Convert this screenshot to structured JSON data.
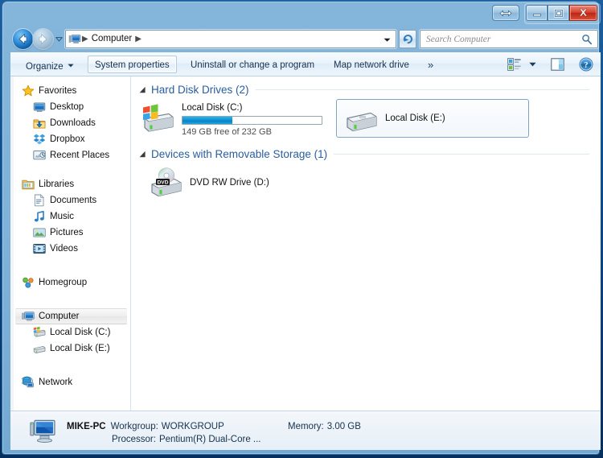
{
  "window": {
    "title": "",
    "buttons": {
      "resize": "resize-restore",
      "minimize": "Minimize",
      "maximize": "Maximize",
      "close": "Close"
    }
  },
  "navigation": {
    "back_label": "Back",
    "forward_label": "Forward",
    "history_label": "Recent pages",
    "refresh_label": "Refresh",
    "breadcrumbs": [
      "Computer"
    ],
    "breadcrumb_separator": "▶"
  },
  "search": {
    "placeholder": "Search Computer",
    "value": "",
    "icon": "search-icon"
  },
  "toolbar": {
    "organize_label": "Organize",
    "organize_caret": "▼",
    "system_properties_label": "System properties",
    "uninstall_label": "Uninstall or change a program",
    "map_network_label": "Map network drive",
    "overflow_label": "»",
    "views_label": "Change your view",
    "views_caret": "▼",
    "preview_label": "Show the preview pane",
    "help_label": "Get help"
  },
  "sidebar": {
    "groups": [
      {
        "name": "Favorites",
        "icon": "star-icon",
        "items": [
          {
            "label": "Desktop",
            "icon": "desktop-icon"
          },
          {
            "label": "Downloads",
            "icon": "downloads-folder-icon"
          },
          {
            "label": "Dropbox",
            "icon": "dropbox-icon"
          },
          {
            "label": "Recent Places",
            "icon": "recent-places-icon"
          }
        ]
      },
      {
        "name": "Libraries",
        "icon": "libraries-icon",
        "items": [
          {
            "label": "Documents",
            "icon": "documents-icon"
          },
          {
            "label": "Music",
            "icon": "music-icon"
          },
          {
            "label": "Pictures",
            "icon": "pictures-icon"
          },
          {
            "label": "Videos",
            "icon": "videos-icon"
          }
        ]
      },
      {
        "name": "Homegroup",
        "icon": "homegroup-icon",
        "items": []
      },
      {
        "name": "Computer",
        "icon": "computer-icon",
        "selected": true,
        "items": [
          {
            "label": "Local Disk (C:)",
            "icon": "system-drive-icon"
          },
          {
            "label": "Local Disk (E:)",
            "icon": "drive-icon"
          }
        ]
      },
      {
        "name": "Network",
        "icon": "network-icon",
        "items": []
      }
    ]
  },
  "content": {
    "groups": [
      {
        "title": "Hard Disk Drives",
        "count": "(2)",
        "header_text": "Hard Disk Drives (2)",
        "items": [
          {
            "name": "Local Disk (C:)",
            "icon": "system-drive-icon",
            "capacity_text": "149 GB free of 232 GB",
            "free_gb": 149,
            "total_gb": 232,
            "used_percent": 36,
            "selected": false
          },
          {
            "name": "Local Disk (E:)",
            "icon": "drive-icon",
            "capacity_text": "",
            "selected": true
          }
        ]
      },
      {
        "title": "Devices with Removable Storage",
        "count": "(1)",
        "header_text": "Devices with Removable Storage (1)",
        "items": [
          {
            "name": "DVD RW Drive (D:)",
            "icon": "dvd-drive-icon",
            "capacity_text": "",
            "selected": false
          }
        ]
      }
    ]
  },
  "details": {
    "computer_name": "MIKE-PC",
    "workgroup_key": "Workgroup:",
    "workgroup_value": "WORKGROUP",
    "memory_key": "Memory:",
    "memory_value": "3.00 GB",
    "processor_key": "Processor:",
    "processor_value": "Pentium(R) Dual-Core ...",
    "icon": "computer-monitor-icon"
  },
  "colors": {
    "frame": "#7fb2d8",
    "group_header": "#2a5d9e",
    "progress_fill": "#0f93d8",
    "close_button": "#d4412c",
    "selection_border": "#7da2c4"
  }
}
